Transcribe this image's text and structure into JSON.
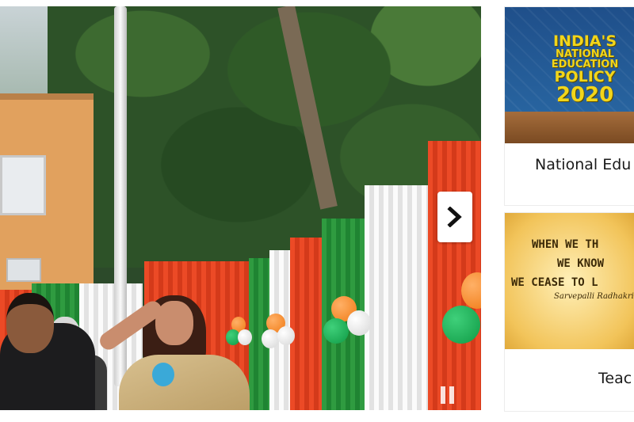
{
  "slider": {
    "next_icon": "chevron-right-icon",
    "pause_icon": "pause-icon"
  },
  "cards": [
    {
      "image_text": [
        "INDIA'S",
        "NATIONAL",
        "EDUCATION",
        "POLICY",
        "2020"
      ],
      "title": "National Edu"
    },
    {
      "image_text": [
        "WHEN WE TH",
        "WE KNOW",
        "WE CEASE TO L"
      ],
      "image_signature": "Sarvepalli Radhakrish",
      "title": "Teac"
    }
  ],
  "colors": {
    "saffron": "#ec4a26",
    "white": "#fbfbfb",
    "green": "#2f9b40",
    "nep_text": "#f2d51a"
  }
}
